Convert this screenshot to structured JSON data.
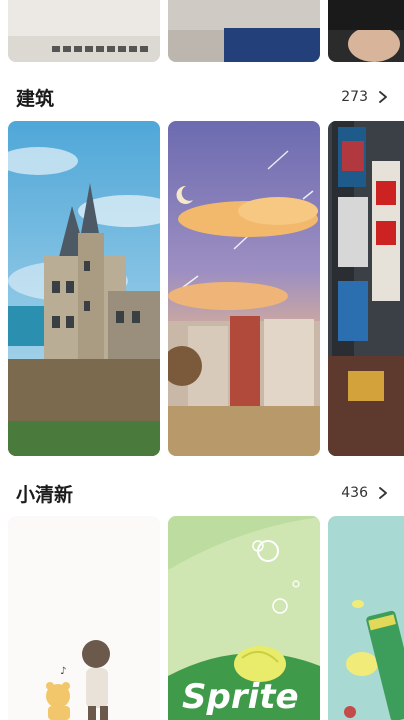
{
  "sections": [
    {
      "title": "建筑",
      "count": "273",
      "more_icon": "chevron-right-icon"
    },
    {
      "title": "小清新",
      "count": "436",
      "more_icon": "chevron-right-icon"
    }
  ],
  "sprite_text": "Sprite"
}
